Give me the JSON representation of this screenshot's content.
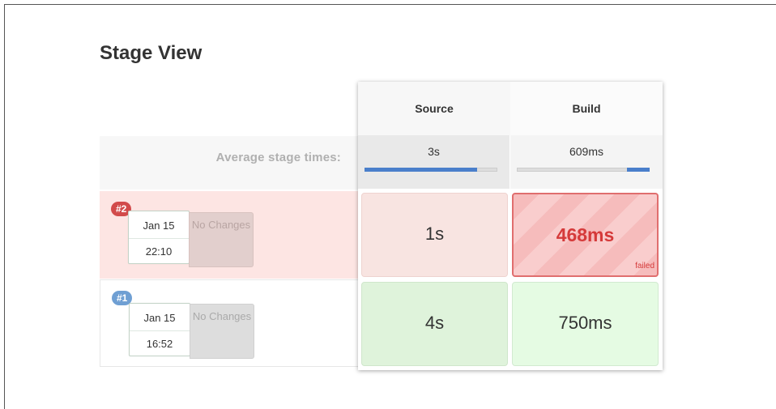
{
  "title": "Stage View",
  "average": {
    "label": "Average stage times:"
  },
  "stages": [
    {
      "name": "Source",
      "avg": "3s",
      "avg_fraction": 0.85
    },
    {
      "name": "Build",
      "avg": "609ms",
      "avg_fraction": 0.17
    }
  ],
  "runs": [
    {
      "badge": "#2",
      "date": "Jan 15",
      "time": "22:10",
      "changes": "No Changes",
      "status": "failed",
      "cells": [
        {
          "value": "1s"
        },
        {
          "value": "468ms",
          "tag": "failed"
        }
      ]
    },
    {
      "badge": "#1",
      "date": "Jan 15",
      "time": "16:52",
      "changes": "No Changes",
      "status": "success",
      "cells": [
        {
          "value": "4s"
        },
        {
          "value": "750ms"
        }
      ]
    }
  ],
  "colors": {
    "failed_badge": "#d24b4b",
    "success_badge": "#6f9fd3",
    "failed_text": "#d53a3a",
    "progress_bar": "#4a7fcb"
  }
}
